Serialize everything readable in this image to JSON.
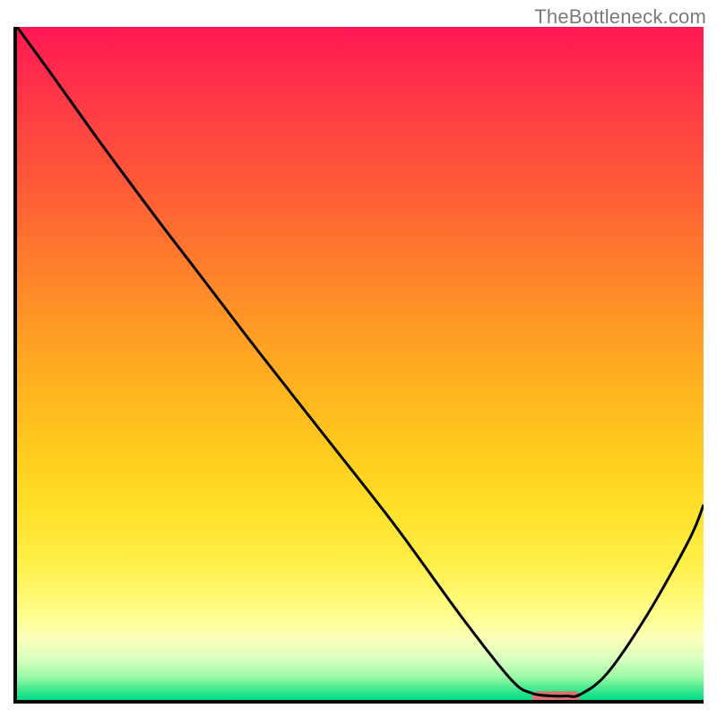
{
  "watermark": "TheBottleneck.com",
  "chart_data": {
    "type": "line",
    "title": "",
    "xlabel": "",
    "ylabel": "",
    "xlim": [
      0,
      100
    ],
    "ylim": [
      0,
      100
    ],
    "grid": false,
    "legend": false,
    "series": [
      {
        "name": "curve",
        "color": "#000000",
        "x": [
          0,
          5,
          12,
          20,
          26,
          35,
          45,
          55,
          65,
          72,
          75,
          78,
          80,
          82,
          86,
          92,
          98,
          100
        ],
        "y": [
          100,
          93,
          83,
          72,
          64,
          52,
          39,
          26,
          12,
          3,
          1,
          0.6,
          0.6,
          0.8,
          4,
          13,
          24,
          29
        ]
      }
    ],
    "marker": {
      "name": "optimal-zone",
      "shape": "rounded-bar",
      "color": "#d9736f",
      "x_start": 75,
      "x_end": 82,
      "y": 0.5
    },
    "background_gradient": {
      "top": "#ff1752",
      "mid": "#ffd51f",
      "bottom": "#00db87"
    }
  }
}
